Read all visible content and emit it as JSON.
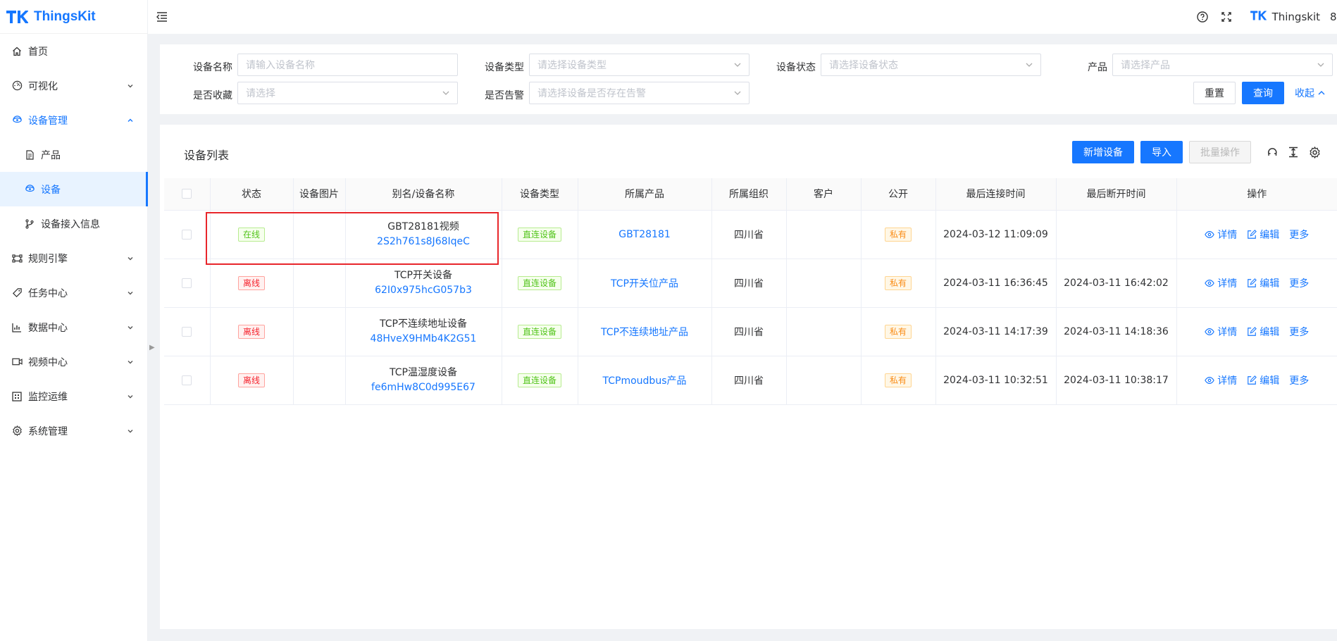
{
  "app": {
    "name": "ThingsKit",
    "brand_color": "#1677ff"
  },
  "header": {
    "user_name": "Thingskit",
    "truncated_char": "8"
  },
  "sidebar": {
    "items": [
      {
        "label": "首页",
        "icon": "home-icon",
        "arrow": ""
      },
      {
        "label": "可视化",
        "icon": "dashboard-icon",
        "arrow": "down"
      },
      {
        "label": "设备管理",
        "icon": "device-icon",
        "arrow": "up",
        "open": true
      },
      {
        "label": "产品",
        "icon": "file-icon",
        "sub": true
      },
      {
        "label": "设备",
        "icon": "device-icon",
        "sub": true,
        "active": true
      },
      {
        "label": "设备接入信息",
        "icon": "branch-icon",
        "sub": true
      },
      {
        "label": "规则引擎",
        "icon": "rule-icon",
        "arrow": "down"
      },
      {
        "label": "任务中心",
        "icon": "task-icon",
        "arrow": "down"
      },
      {
        "label": "数据中心",
        "icon": "chart-icon",
        "arrow": "down"
      },
      {
        "label": "视频中心",
        "icon": "video-icon",
        "arrow": "down"
      },
      {
        "label": "监控运维",
        "icon": "monitor-icon",
        "arrow": "down"
      },
      {
        "label": "系统管理",
        "icon": "gear-icon",
        "arrow": "down"
      }
    ]
  },
  "filters": {
    "device_name": {
      "label": "设备名称",
      "placeholder": "请输入设备名称"
    },
    "device_type": {
      "label": "设备类型",
      "placeholder": "请选择设备类型"
    },
    "device_status": {
      "label": "设备状态",
      "placeholder": "请选择设备状态"
    },
    "product": {
      "label": "产品",
      "placeholder": "请选择产品"
    },
    "favorited": {
      "label": "是否收藏",
      "placeholder": "请选择"
    },
    "alarm": {
      "label": "是否告警",
      "placeholder": "请选择设备是否存在告警"
    },
    "reset_label": "重置",
    "query_label": "查询",
    "collapse_label": "收起"
  },
  "list": {
    "title": "设备列表",
    "add_label": "新增设备",
    "import_label": "导入",
    "batch_label": "批量操作",
    "columns": [
      "状态",
      "设备图片",
      "别名/设备名称",
      "设备类型",
      "所属产品",
      "所属组织",
      "客户",
      "公开",
      "最后连接时间",
      "最后断开时间",
      "操作"
    ],
    "ops": {
      "detail": "详情",
      "edit": "编辑",
      "more": "更多"
    },
    "rows": [
      {
        "status": "在线",
        "status_kind": "online",
        "name": "GBT28181视频",
        "id": "2S2h761s8J68IqeC",
        "type": "直连设备",
        "product": "GBT28181",
        "org": "四川省",
        "customer": "",
        "public": "私有",
        "last_connect": "2024-03-12 11:09:09",
        "last_disconnect": ""
      },
      {
        "status": "离线",
        "status_kind": "offline",
        "name": "TCP开关设备",
        "id": "62I0x975hcG057b3",
        "type": "直连设备",
        "product": "TCP开关位产品",
        "org": "四川省",
        "customer": "",
        "public": "私有",
        "last_connect": "2024-03-11 16:36:45",
        "last_disconnect": "2024-03-11 16:42:02"
      },
      {
        "status": "离线",
        "status_kind": "offline",
        "name": "TCP不连续地址设备",
        "id": "48HveX9HMb4K2G51",
        "type": "直连设备",
        "product": "TCP不连续地址产品",
        "org": "四川省",
        "customer": "",
        "public": "私有",
        "last_connect": "2024-03-11 14:17:39",
        "last_disconnect": "2024-03-11 14:18:36"
      },
      {
        "status": "离线",
        "status_kind": "offline",
        "name": "TCP温湿度设备",
        "id": "fe6mHw8C0d995E67",
        "type": "直连设备",
        "product": "TCPmoudbus产品",
        "org": "四川省",
        "customer": "",
        "public": "私有",
        "last_connect": "2024-03-11 10:32:51",
        "last_disconnect": "2024-03-11 10:38:17"
      }
    ]
  },
  "colors": {
    "online": "#52c41a",
    "offline": "#f5222d",
    "private": "#fa8c16",
    "highlight": "#e8262b"
  }
}
